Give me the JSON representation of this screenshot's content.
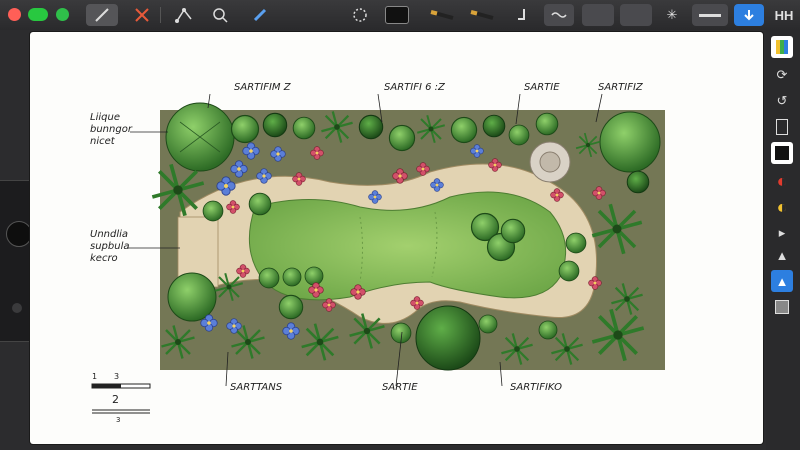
{
  "window": {
    "title": ""
  },
  "toolbar": {
    "tools": [
      "pencil-tool",
      "crop-tool",
      "node-tool",
      "lasso-tool",
      "brush-tool",
      "timer-tool",
      "layer-swatch",
      "marker-tool",
      "marker-tool-2",
      "text-tool",
      "wave-tool",
      "blank-tool",
      "star-tool",
      "line-tool",
      "share-tool",
      "grid-tool"
    ],
    "right_label": "HH"
  },
  "sidebar": {
    "items": [
      "layers",
      "rotate",
      "undo",
      "panel",
      "black",
      "color-red",
      "color-yellow",
      "arrow",
      "flask",
      "bucket",
      "gallery"
    ]
  },
  "plan": {
    "labels": {
      "top1": "SARTIFIM Z",
      "top2": "SARTIFI 6 :Z",
      "top3": "SARTIE",
      "top4": "SARTIFIZ",
      "left1": "Liique\nbunngor\nnicet",
      "left2": "Unndlia\nsupbula\nkecro",
      "bottom1": "SARTTANS",
      "bottom2": "SARTIE",
      "bottom3": "SARTIFIKO"
    },
    "scale": {
      "n1": "1",
      "n2": "2",
      "n3": "3"
    }
  },
  "colors": {
    "lawn": "#7fb85a",
    "path": "#e2d3b2",
    "dark_green": "#2f6b2a",
    "blue": "#2d7fe0"
  }
}
